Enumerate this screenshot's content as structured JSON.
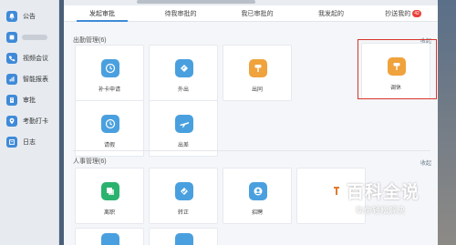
{
  "sidebar": {
    "items": [
      {
        "label": "公告",
        "icon": "bell-icon",
        "color": "#3f8ad8"
      },
      {
        "label": "",
        "icon": "app-icon",
        "color": "#3f8ad8",
        "blurred": true
      },
      {
        "label": "视频会议",
        "icon": "phone-icon",
        "color": "#3f8ad8"
      },
      {
        "label": "智能报表",
        "icon": "chart-icon",
        "color": "#3f8ad8"
      },
      {
        "label": "审批",
        "icon": "document-icon",
        "color": "#3f8ad8"
      },
      {
        "label": "考勤打卡",
        "icon": "location-icon",
        "color": "#3f8ad8"
      },
      {
        "label": "日志",
        "icon": "log-icon",
        "color": "#3f8ad8"
      }
    ]
  },
  "tabs": [
    {
      "label": "发起审批",
      "active": true
    },
    {
      "label": "待我审批的"
    },
    {
      "label": "我已审批的"
    },
    {
      "label": "我发起的"
    },
    {
      "label": "抄送我的",
      "badge": "42"
    }
  ],
  "sections": [
    {
      "title": "出勤管理(6)",
      "collapse": "收起",
      "items": [
        {
          "label": "补卡申请",
          "icon": "clock-icon",
          "color": "#4aa0de"
        },
        {
          "label": "外出",
          "icon": "outing-icon",
          "color": "#4aa0de"
        },
        {
          "label": "出同",
          "icon": "paint-roller-icon",
          "color": "#f0a23c"
        },
        {
          "label": "调休",
          "icon": "paint-roller-icon",
          "color": "#f0a23c"
        },
        {
          "label": "请假",
          "icon": "clock-icon",
          "color": "#4aa0de"
        },
        {
          "label": "出差",
          "icon": "airplane-icon",
          "color": "#4aa0de"
        }
      ]
    },
    {
      "title": "人事管理(6)",
      "collapse": "收起",
      "items": [
        {
          "label": "离职",
          "icon": "leave-icon",
          "color": "#2bb26e"
        },
        {
          "label": "转正",
          "icon": "regularize-icon",
          "color": "#4aa0de"
        },
        {
          "label": "招聘",
          "icon": "recruit-icon",
          "color": "#4aa0de"
        }
      ]
    }
  ],
  "watermark": {
    "title": "百科全说",
    "subtitle": "助你轻松解决"
  }
}
